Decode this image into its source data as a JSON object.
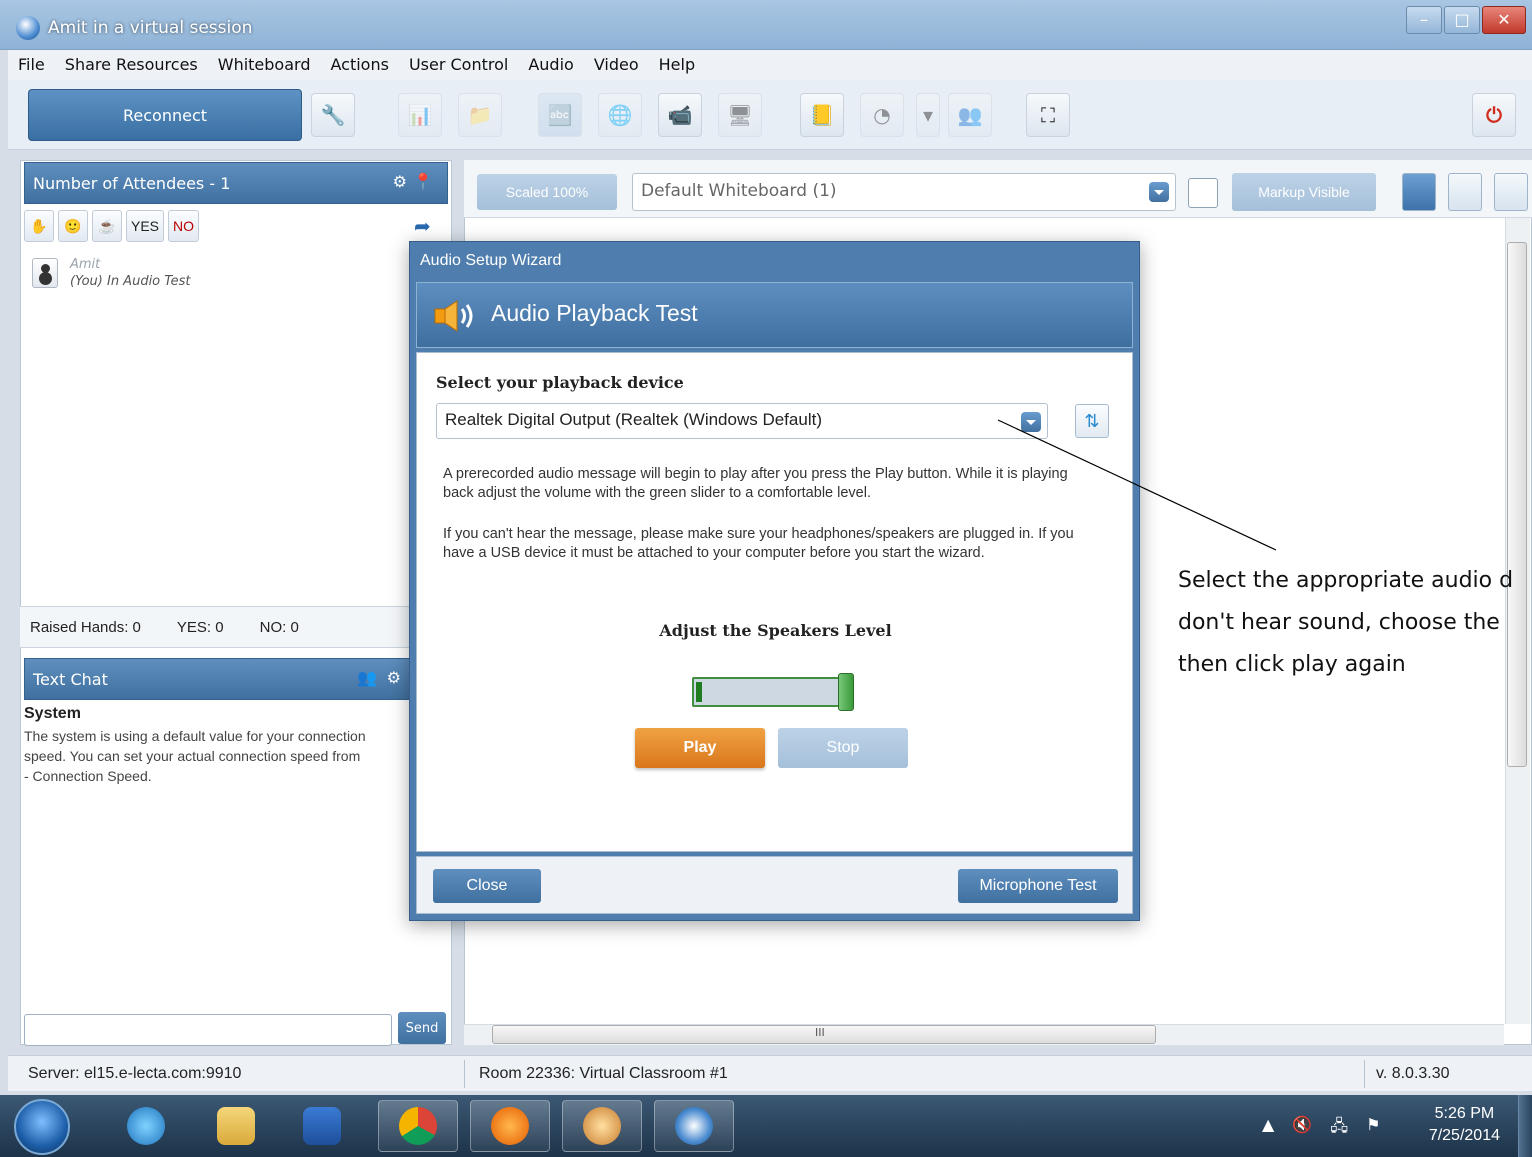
{
  "window": {
    "title": "Amit in a virtual session"
  },
  "menu": [
    "File",
    "Share Resources",
    "Whiteboard",
    "Actions",
    "User Control",
    "Audio",
    "Video",
    "Help"
  ],
  "toolbar": {
    "reconnect_label": "Reconnect"
  },
  "attendees": {
    "header": "Number of Attendees - 1",
    "yes_label": "YES",
    "no_label": "NO",
    "list": [
      {
        "name": "Amit",
        "status": "(You) In Audio Test"
      }
    ],
    "counts": {
      "raised": "Raised Hands: 0",
      "yes": "YES: 0",
      "no": "NO: 0"
    }
  },
  "chat": {
    "header": "Text Chat",
    "sender": "System",
    "message": "The system is using a default value for your connection\nspeed. You can set your actual connection speed from\n- Connection Speed.",
    "send_label": "Send"
  },
  "whiteboard": {
    "scaled_label": "Scaled 100%",
    "selected": "Default Whiteboard (1)",
    "markup_label": "Markup Visible",
    "hscroll_grip": "III"
  },
  "status": {
    "server": "Server: el15.e-lecta.com:9910",
    "room": "Room 22336: Virtual Classroom #1",
    "version": "v. 8.0.3.30"
  },
  "dialog": {
    "title": "Audio Setup Wizard",
    "banner": "Audio Playback Test",
    "select_label": "Select your playback device",
    "device": "Realtek Digital Output (Realtek (Windows Default)",
    "instructions1": "A prerecorded audio message will begin to play after you press the Play button. While it is playing back adjust the volume with the green slider to a comfortable level.",
    "instructions2": "If you can't hear the message, please make sure your headphones/speakers are plugged in. If you have a USB device it must be attached to your computer before you start the wizard.",
    "speakers_label": "Adjust the Speakers Level",
    "speaker_level": 0.03,
    "play_label": "Play",
    "stop_label": "Stop",
    "close_label": "Close",
    "mic_label": "Microphone Test"
  },
  "annotation": {
    "line1": "Select the appropriate audio d",
    "line2": "don't hear sound, choose the",
    "line3": "then click play again"
  },
  "taskbar": {
    "time": "5:26 PM",
    "date": "7/25/2014"
  },
  "colors": {
    "accent": "#4f7eae",
    "play": "#e38a2c",
    "slider": "#1f7d1f"
  }
}
